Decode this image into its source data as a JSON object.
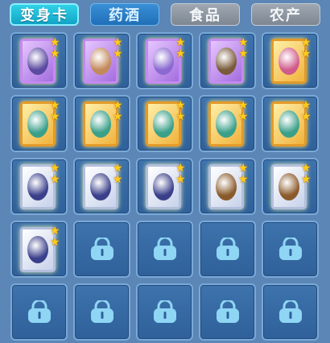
{
  "tabs": [
    {
      "label": "变身卡",
      "style": "active"
    },
    {
      "label": "药酒",
      "style": "blue"
    },
    {
      "label": "食品",
      "style": "grey"
    },
    {
      "label": "农产",
      "style": "grey"
    }
  ],
  "star_glyph": "★",
  "colors": {
    "accent": "#12a3c6",
    "lock": "#8fd6f5",
    "background": "#5b86b6"
  },
  "slots": [
    {
      "type": "card",
      "frame": "purple",
      "art": "dragon",
      "art_color": "#5a4aa0",
      "stars": 2
    },
    {
      "type": "card",
      "frame": "purple",
      "art": "monkey",
      "art_color": "#c28a5a",
      "stars": 2
    },
    {
      "type": "card",
      "frame": "purple",
      "art": "spirit",
      "art_color": "#8a6ad0",
      "stars": 2
    },
    {
      "type": "card",
      "frame": "purple",
      "art": "warrior",
      "art_color": "#7a5a3a",
      "stars": 2
    },
    {
      "type": "card",
      "frame": "gold",
      "art": "fairy",
      "art_color": "#d05a8a",
      "stars": 2
    },
    {
      "type": "card",
      "frame": "gold",
      "art": "rabbit-dancer",
      "art_color": "#3aa08a",
      "stars": 2
    },
    {
      "type": "card",
      "frame": "gold",
      "art": "rabbit-dancer",
      "art_color": "#3aa08a",
      "stars": 2
    },
    {
      "type": "card",
      "frame": "gold",
      "art": "rabbit-dancer",
      "art_color": "#3aa08a",
      "stars": 2
    },
    {
      "type": "card",
      "frame": "gold",
      "art": "rabbit-dancer",
      "art_color": "#3aa08a",
      "stars": 2
    },
    {
      "type": "card",
      "frame": "gold",
      "art": "rabbit-dancer",
      "art_color": "#3aa08a",
      "stars": 2
    },
    {
      "type": "card",
      "frame": "silver",
      "art": "beast",
      "art_color": "#3a3f8a",
      "stars": 2
    },
    {
      "type": "card",
      "frame": "silver",
      "art": "beast",
      "art_color": "#3a3f8a",
      "stars": 2
    },
    {
      "type": "card",
      "frame": "silver",
      "art": "beast",
      "art_color": "#3a3f8a",
      "stars": 2
    },
    {
      "type": "card",
      "frame": "silver",
      "art": "bear",
      "art_color": "#8a5a2a",
      "stars": 2
    },
    {
      "type": "card",
      "frame": "silver",
      "art": "bear",
      "art_color": "#8a5a2a",
      "stars": 2
    },
    {
      "type": "card",
      "frame": "silver",
      "art": "beast",
      "art_color": "#3a3f8a",
      "stars": 2
    },
    {
      "type": "locked"
    },
    {
      "type": "locked"
    },
    {
      "type": "locked"
    },
    {
      "type": "locked"
    },
    {
      "type": "locked"
    },
    {
      "type": "locked"
    },
    {
      "type": "locked"
    },
    {
      "type": "locked"
    },
    {
      "type": "locked"
    }
  ]
}
